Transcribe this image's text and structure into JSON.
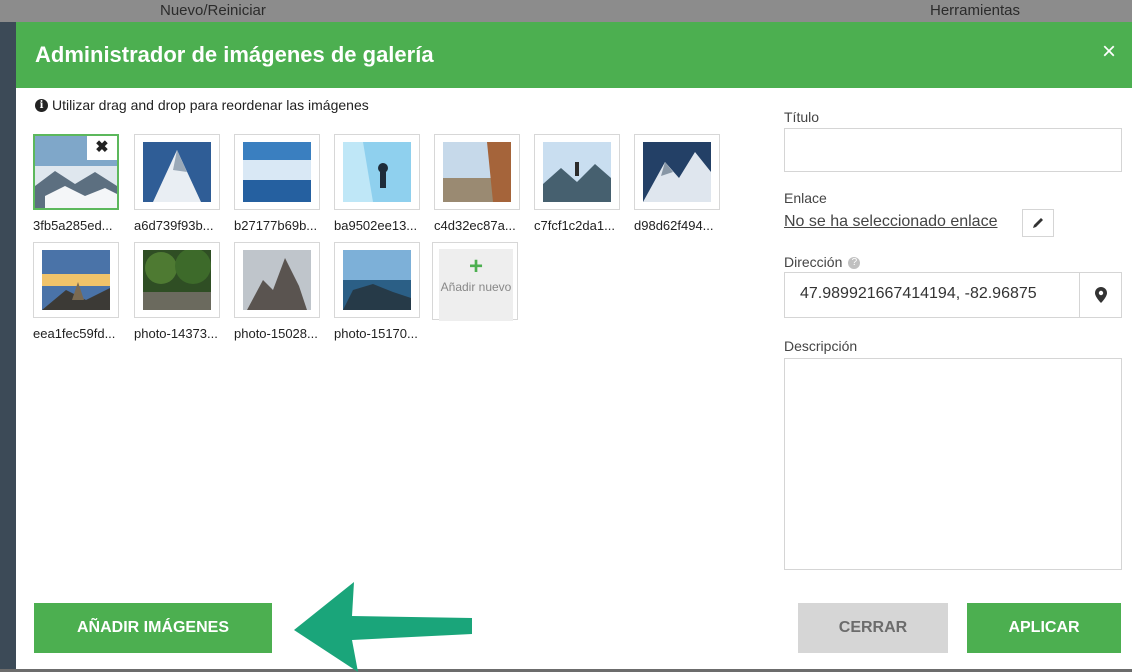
{
  "background": {
    "toolbar_new_reset": "Nuevo/Reiniciar",
    "toolbar_tools": "Herramientas"
  },
  "modal": {
    "title": "Administrador de imágenes de galería",
    "close_symbol": "×",
    "hint": "Utilizar drag and drop para reordenar las imágenes",
    "images": [
      {
        "label": "3fb5a285ed...",
        "selected": true,
        "remove_symbol": "✖"
      },
      {
        "label": "a6d739f93b..."
      },
      {
        "label": "b27177b69b..."
      },
      {
        "label": "ba9502ee13..."
      },
      {
        "label": "c4d32ec87a..."
      },
      {
        "label": "c7fcf1c2da1..."
      },
      {
        "label": "d98d62f494..."
      },
      {
        "label": "eea1fec59fd..."
      },
      {
        "label": "photo-14373..."
      },
      {
        "label": "photo-15028..."
      },
      {
        "label": "photo-15170..."
      }
    ],
    "add_new": {
      "plus": "+",
      "label": "Añadir nuevo"
    },
    "form": {
      "title_label": "Título",
      "title_value": "",
      "link_label": "Enlace",
      "link_value": "No se ha seleccionado enlace",
      "address_label": "Dirección",
      "address_value": "47.989921667414194, -82.96875",
      "description_label": "Descripción",
      "description_value": ""
    },
    "buttons": {
      "add_images": "AÑADIR IMÁGENES",
      "close": "CERRAR",
      "apply": "APLICAR"
    }
  },
  "colors": {
    "header": "#4caf50",
    "primary_button": "#4caf50",
    "secondary_button": "#d6d6d6",
    "arrow": "#1aa57a"
  }
}
